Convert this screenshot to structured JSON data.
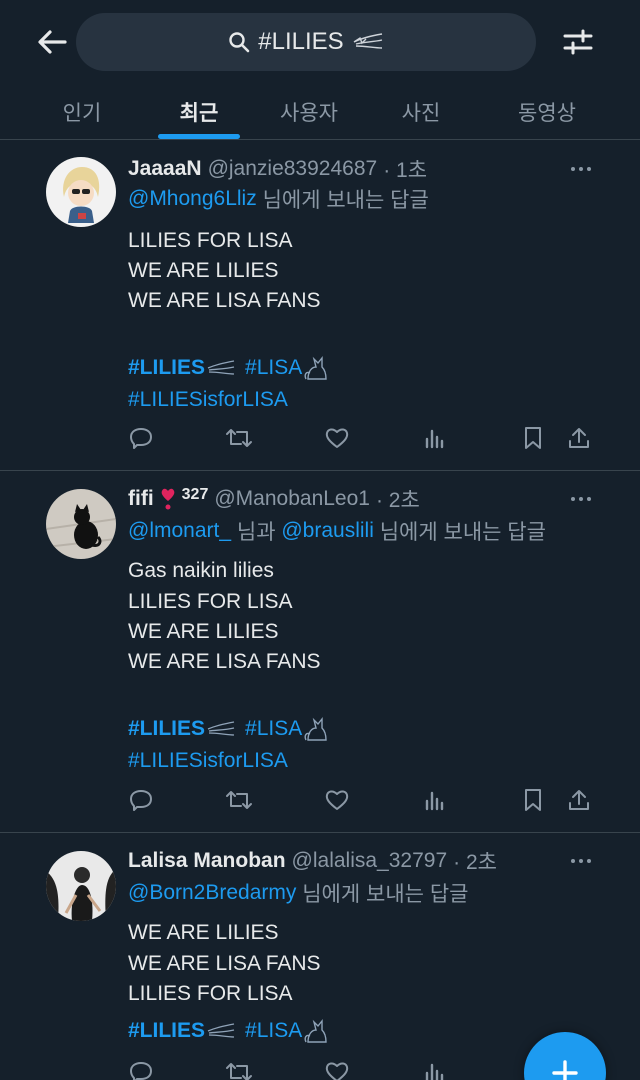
{
  "search": {
    "query": "#LILIES"
  },
  "tabs": [
    {
      "label": "인기",
      "active": false
    },
    {
      "label": "최근",
      "active": true
    },
    {
      "label": "사용자",
      "active": false
    },
    {
      "label": "사진",
      "active": false
    },
    {
      "label": "동영상",
      "active": false
    }
  ],
  "tweets": [
    {
      "name": "JaaaaN",
      "handle": "@janzie83924687",
      "time": "· 1초",
      "reply_to": [
        "@Mhong6Lliz"
      ],
      "reply_suffix": "님에게 보내는 답글",
      "lines": [
        "LILIES FOR LISA",
        "WE ARE LILIES",
        "WE ARE LISA FANS"
      ],
      "hashtags_row1": [
        "#LILIES",
        "#LISA"
      ],
      "hashtags_row2": [
        "#LILIESisforLISA"
      ]
    },
    {
      "name": "fifi",
      "badge": "327",
      "handle": "@ManobanLeo1",
      "time": "· 2초",
      "reply_to": [
        "@lmonart_",
        "@brauslili"
      ],
      "reply_join": "님과",
      "reply_suffix": "님에게 보내는 답글",
      "lines": [
        "Gas naikin lilies",
        "LILIES FOR LISA",
        "WE ARE LILIES",
        "WE ARE LISA FANS"
      ],
      "hashtags_row1": [
        "#LILIES",
        "#LISA"
      ],
      "hashtags_row2": [
        "#LILIESisforLISA"
      ]
    },
    {
      "name": "Lalisa Manoban",
      "handle": "@lalalisa_32797",
      "time": "· 2초",
      "reply_to": [
        "@Born2Bredarmy"
      ],
      "reply_suffix": "님에게 보내는 답글",
      "lines": [
        "WE ARE LILIES",
        "WE ARE LISA FANS",
        "LILIES FOR LISA"
      ],
      "hashtags_row1": [
        "#LILIES",
        "#LISA"
      ]
    }
  ],
  "icons": {
    "back": "arrow-left-icon",
    "search": "search-icon",
    "filter": "sliders-icon",
    "reply": "reply-icon",
    "retweet": "retweet-icon",
    "like": "heart-icon",
    "views": "views-icon",
    "bookmark": "bookmark-icon",
    "share": "share-icon",
    "compose": "plus-icon"
  },
  "colors": {
    "background": "#15202b",
    "accent": "#1d9bf0",
    "secondary_text": "#8b98a5",
    "divider": "#38444d"
  }
}
